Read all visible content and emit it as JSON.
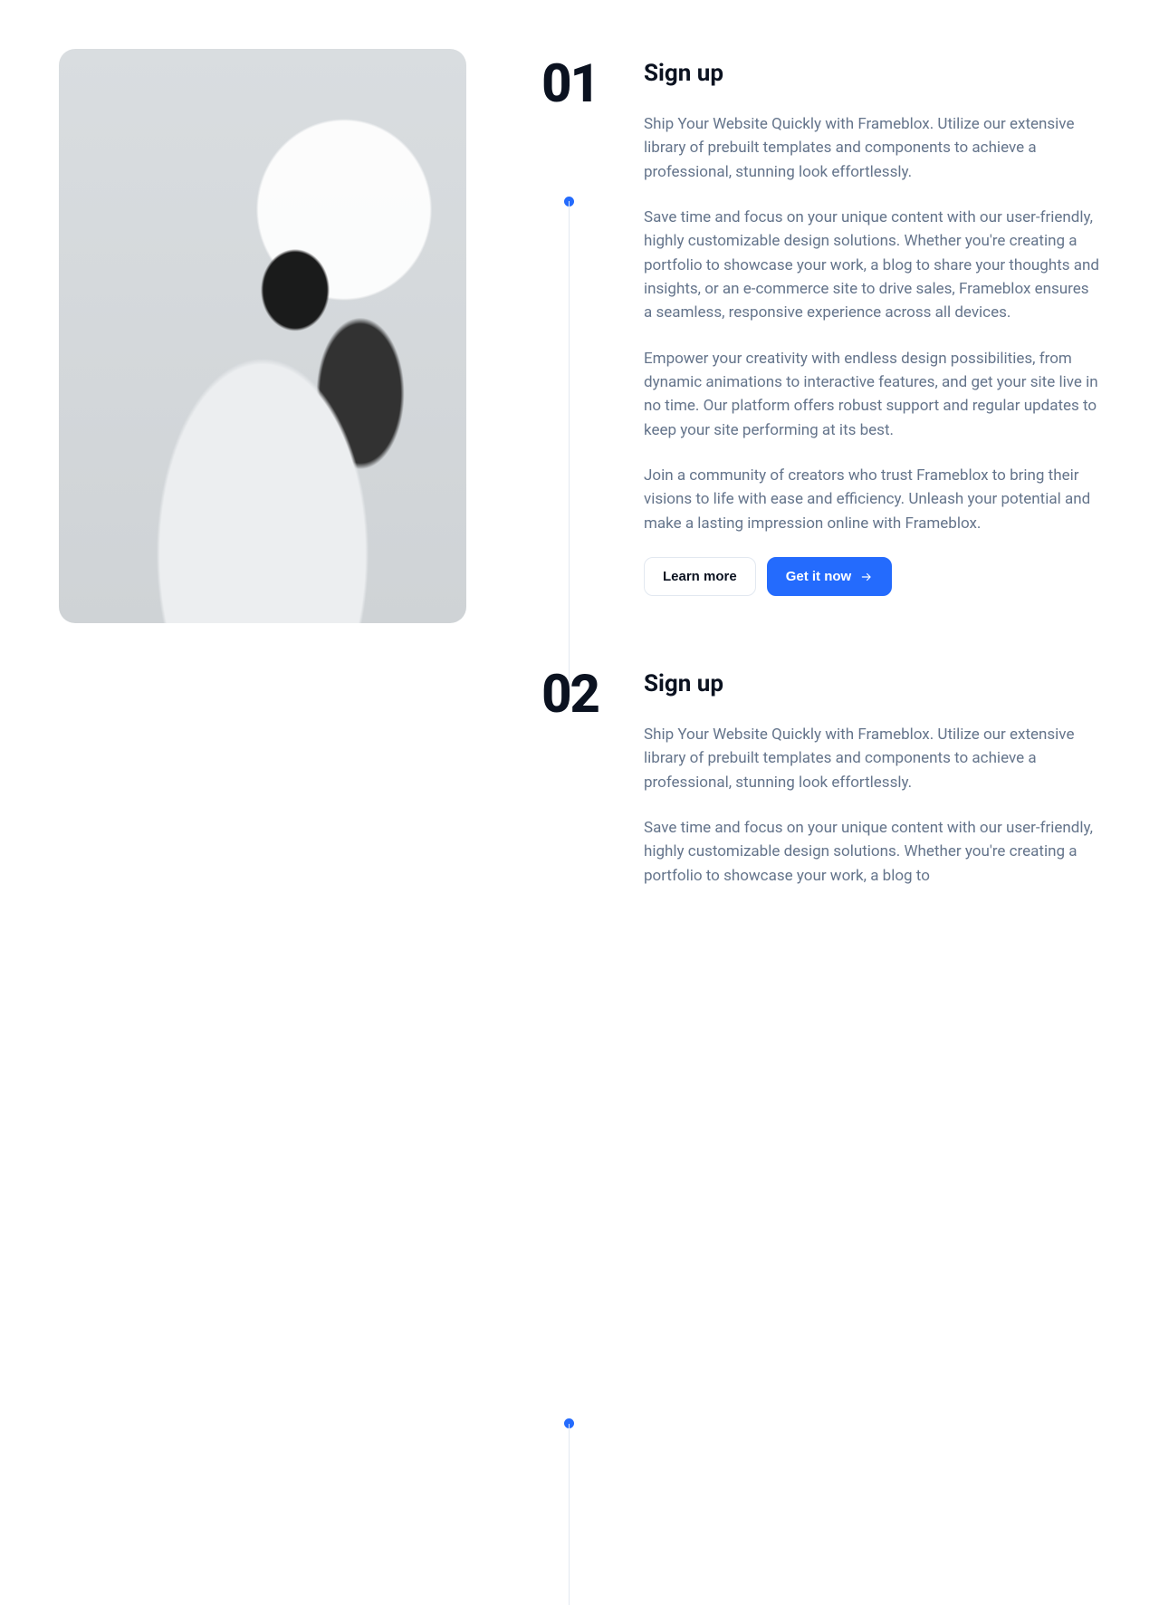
{
  "steps": [
    {
      "number": "01",
      "title": "Sign up",
      "paragraphs": [
        "Ship Your Website Quickly with Frameblox. Utilize our extensive library of prebuilt templates and components to achieve a professional, stunning look effortlessly.",
        "Save time and focus on your unique content with our user-friendly, highly customizable design solutions. Whether you're creating a portfolio to showcase your work, a blog to share your thoughts and insights, or an e-commerce site to drive sales, Frameblox ensures a seamless, responsive experience across all devices.",
        "Empower your creativity with endless design possibilities, from dynamic animations to interactive features, and get your site live in no time. Our platform offers robust support and regular updates to keep your site performing at its best.",
        "Join a community of creators who trust Frameblox to bring their visions to life with ease and efficiency. Unleash your potential and make a lasting impression online with Frameblox."
      ],
      "buttons": {
        "secondary": "Learn more",
        "primary": "Get it now"
      }
    },
    {
      "number": "02",
      "title": "Sign up",
      "paragraphs": [
        "Ship Your Website Quickly with Frameblox. Utilize our extensive library of prebuilt templates and components to achieve a professional, stunning look effortlessly.",
        "Save time and focus on your unique content with our user-friendly, highly customizable design solutions. Whether you're creating a portfolio to showcase your work, a blog to"
      ]
    }
  ],
  "colors": {
    "accent": "#246bfd",
    "muted": "#64748b",
    "rail": "#e2e8f0"
  },
  "image_alt": "Person wearing a white VR headset and white turtleneck, side profile"
}
